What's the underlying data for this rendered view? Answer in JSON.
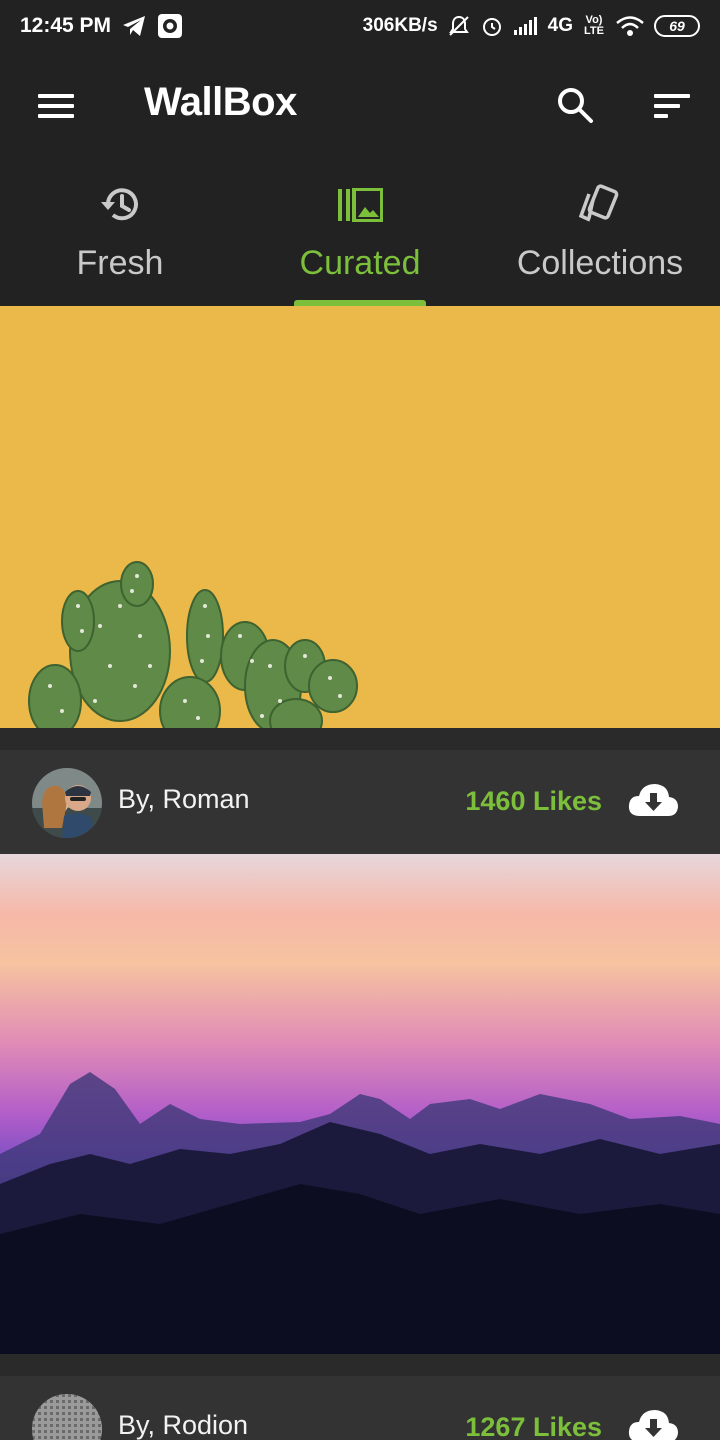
{
  "status_bar": {
    "time": "12:45 PM",
    "speed": "306KB/s",
    "network": "4G",
    "volte": "Vo) LTE",
    "battery": "69",
    "icons": [
      "telegram-icon",
      "record-icon",
      "mute-bell-icon",
      "alarm-icon",
      "signal-icon",
      "wifi-icon",
      "battery-icon"
    ]
  },
  "toolbar": {
    "title": "WallBox",
    "icons": [
      "menu-icon",
      "search-icon",
      "sort-icon"
    ]
  },
  "tabs": [
    {
      "label": "Fresh",
      "icon": "history-icon",
      "active": false
    },
    {
      "label": "Curated",
      "icon": "curated-gallery-icon",
      "active": true
    },
    {
      "label": "Collections",
      "icon": "collections-icon",
      "active": false
    }
  ],
  "wallpapers": [
    {
      "author": "By, Roman",
      "likes": "1460 Likes",
      "image": "yellow background with cactus",
      "download_icon": "cloud-download-icon"
    },
    {
      "author": "By, Rodion",
      "likes": "1267 Likes",
      "image": "purple sunset over mountains",
      "download_icon": "cloud-download-icon"
    }
  ],
  "colors": {
    "accent": "#7cbf3a",
    "bar": "#222222",
    "card": "#333333",
    "cactus_bg": "#ebb94a"
  }
}
